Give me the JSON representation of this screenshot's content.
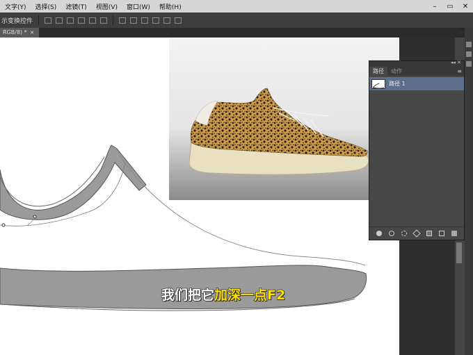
{
  "menubar": {
    "items": [
      "文字(Y)",
      "选择(S)",
      "滤镜(T)",
      "视图(V)",
      "窗口(W)",
      "帮助(H)"
    ],
    "window_controls": [
      "–",
      "▭",
      "✕"
    ]
  },
  "options_bar": {
    "label": "示变换控件"
  },
  "document_tab": {
    "label": "RGB/8) *",
    "close": "×"
  },
  "paths_panel": {
    "tabs": [
      "路径",
      "动作"
    ],
    "active_tab": 0,
    "header_controls": "◂◂ ✕",
    "menu_icon": "≡",
    "paths": [
      {
        "name": "路径 1",
        "selected": true
      }
    ],
    "footer_icons": [
      "fill-path-icon",
      "stroke-path-icon",
      "load-as-selection-icon",
      "make-work-path-icon",
      "add-mask-icon",
      "new-path-icon",
      "delete-path-icon"
    ]
  },
  "subtitle": {
    "part1": "我们把它",
    "part2": "加深一点F2",
    "color_white": "#ffffff",
    "color_yellow": "#ffe100"
  },
  "colors": {
    "menubar_bg": "#d6d6d6",
    "ui_dark": "#2b2b2b",
    "panel_bg": "#474747",
    "selection": "#5b6e8c",
    "shoe_gray": "#9a9a9a"
  }
}
